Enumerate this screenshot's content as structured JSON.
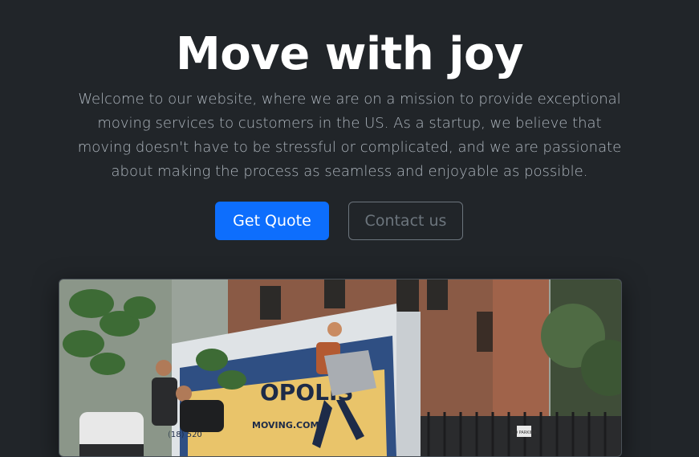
{
  "hero": {
    "title": "Move with joy",
    "lead": "Welcome to our website, where we are on a mission to provide exceptional moving services to customers in the US. As a startup, we believe that moving doesn't have to be stressful or complicated, and we are passionate about making the process as seamless and enjoyable as possible.",
    "primary_button": "Get Quote",
    "secondary_button": "Contact us"
  },
  "photo": {
    "truck_brand": "OPOLIS",
    "truck_url": "MOVING.COM",
    "truck_phone": "(18) 520",
    "sign_text": "NO PARKING"
  },
  "colors": {
    "background": "#212529",
    "primary": "#0d6efd",
    "outline": "#6c757d"
  }
}
